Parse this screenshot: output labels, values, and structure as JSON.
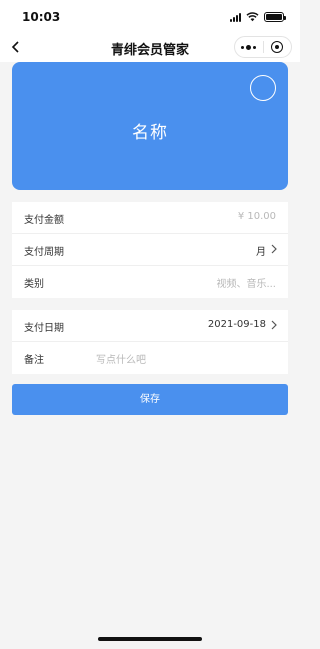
{
  "status_bar": {
    "time": "10:03"
  },
  "nav": {
    "title": "青绯会员管家",
    "more_icon": "more-dots-icon",
    "close_icon": "target-icon"
  },
  "card": {
    "name": "名称",
    "color": "#4a90ee"
  },
  "form_group_1": [
    {
      "label": "支付金额",
      "value": "¥ 10.00",
      "placeholder": true,
      "chevron": false
    },
    {
      "label": "支付周期",
      "value": "月",
      "placeholder": false,
      "chevron": true
    },
    {
      "label": "类别",
      "value": "视频、音乐...",
      "placeholder": true,
      "chevron": false
    }
  ],
  "form_group_2": {
    "date_label": "支付日期",
    "date_value": "2021-09-18",
    "note_label": "备注",
    "note_placeholder": "写点什么吧"
  },
  "save_label": "保存"
}
